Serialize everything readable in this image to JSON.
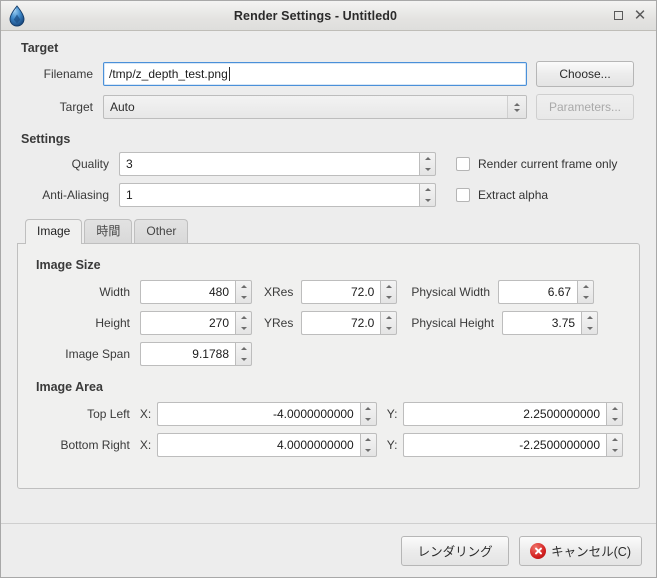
{
  "window": {
    "title": "Render Settings - Untitled0",
    "app_icon": "synfig-teardrop-icon",
    "maximize_label": "",
    "close_label": "✕"
  },
  "target": {
    "section_label": "Target",
    "filename_label": "Filename",
    "filename_value": "/tmp/z_depth_test.png",
    "choose_label": "Choose...",
    "target_label": "Target",
    "target_value": "Auto",
    "parameters_label": "Parameters..."
  },
  "settings": {
    "section_label": "Settings",
    "quality_label": "Quality",
    "quality_value": "3",
    "antialiasing_label": "Anti-Aliasing",
    "antialiasing_value": "1",
    "render_current_frame_label": "Render current frame only",
    "render_current_frame_checked": false,
    "extract_alpha_label": "Extract alpha",
    "extract_alpha_checked": false
  },
  "tabs": [
    {
      "label": "Image",
      "active": true
    },
    {
      "label": "時間",
      "active": false
    },
    {
      "label": "Other",
      "active": false
    }
  ],
  "image_size": {
    "group_label": "Image Size",
    "width_label": "Width",
    "width_value": "480",
    "xres_label": "XRes",
    "xres_value": "72.0",
    "physical_width_label": "Physical Width",
    "physical_width_value": "6.67",
    "height_label": "Height",
    "height_value": "270",
    "yres_label": "YRes",
    "yres_value": "72.0",
    "physical_height_label": "Physical Height",
    "physical_height_value": "3.75",
    "image_span_label": "Image Span",
    "image_span_value": "9.1788"
  },
  "image_area": {
    "group_label": "Image Area",
    "top_left_label": "Top Left",
    "top_left_x_label": "X:",
    "top_left_x_value": "-4.0000000000",
    "top_left_y_label": "Y:",
    "top_left_y_value": "2.2500000000",
    "bottom_right_label": "Bottom Right",
    "bottom_right_x_label": "X:",
    "bottom_right_x_value": "4.0000000000",
    "bottom_right_y_label": "Y:",
    "bottom_right_y_value": "-2.2500000000"
  },
  "actions": {
    "render_label": "レンダリング",
    "cancel_label": "キャンセル(C)"
  },
  "colors": {
    "accent_focus": "#4a90d9",
    "cancel_red": "#d21f1f",
    "window_bg": "#ededed",
    "panel_bg": "#f0f0ef"
  }
}
